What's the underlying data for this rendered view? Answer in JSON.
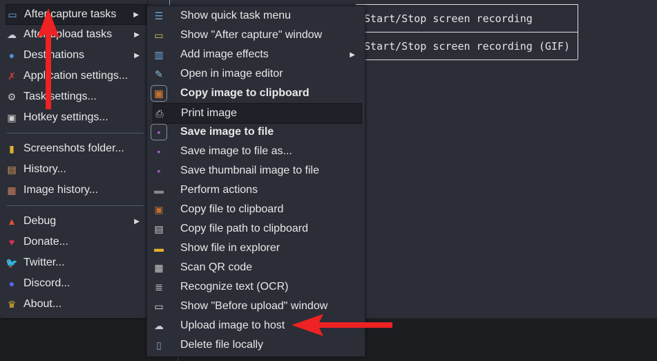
{
  "left_menu": {
    "items": [
      {
        "label": "After capture tasks",
        "icon": "capture-tasks-icon",
        "glyph": "▭",
        "color": "#6fa8dc",
        "submenu": true
      },
      {
        "label": "After upload tasks",
        "icon": "cloud-upload-icon",
        "glyph": "☁",
        "color": "#c8c8d8",
        "submenu": true
      },
      {
        "label": "Destinations",
        "icon": "destinations-icon",
        "glyph": "●",
        "color": "#4a90d9",
        "submenu": true
      },
      {
        "label": "Application settings...",
        "icon": "tools-icon",
        "glyph": "✗",
        "color": "#d04040"
      },
      {
        "label": "Task settings...",
        "icon": "gear-icon",
        "glyph": "⚙",
        "color": "#cccccc"
      },
      {
        "label": "Hotkey settings...",
        "icon": "keyboard-key-icon",
        "glyph": "▣",
        "color": "#cfcfcf"
      },
      {
        "label": "Screenshots folder...",
        "icon": "folder-icon",
        "glyph": "▮",
        "color": "#e0b030"
      },
      {
        "label": "History...",
        "icon": "history-icon",
        "glyph": "▤",
        "color": "#e0a060"
      },
      {
        "label": "Image history...",
        "icon": "image-history-icon",
        "glyph": "▦",
        "color": "#d08060"
      },
      {
        "label": "Debug",
        "icon": "debug-cone-icon",
        "glyph": "▲",
        "color": "#e05030",
        "submenu": true
      },
      {
        "label": "Donate...",
        "icon": "heart-icon",
        "glyph": "♥",
        "color": "#e03050"
      },
      {
        "label": "Twitter...",
        "icon": "twitter-icon",
        "glyph": "🐦",
        "color": "#1da1f2"
      },
      {
        "label": "Discord...",
        "icon": "discord-icon",
        "glyph": "●",
        "color": "#5865f2"
      },
      {
        "label": "About...",
        "icon": "crown-icon",
        "glyph": "♛",
        "color": "#e0b030"
      }
    ]
  },
  "sub_menu": {
    "items": [
      {
        "label": "Show quick task menu",
        "icon": "quick-task-menu-icon",
        "glyph": "☰",
        "color": "#6fa8dc"
      },
      {
        "label": "Show \"After capture\" window",
        "icon": "window-icon",
        "glyph": "▭",
        "color": "#e0c060"
      },
      {
        "label": "Add image effects",
        "icon": "image-effects-icon",
        "glyph": "▥",
        "color": "#6fa8dc",
        "submenu": true
      },
      {
        "label": "Open in image editor",
        "icon": "image-editor-icon",
        "glyph": "✎",
        "color": "#8fc0e0"
      },
      {
        "label": "Copy image to clipboard",
        "icon": "clipboard-icon",
        "glyph": "▣",
        "color": "#c07030",
        "checked": true
      },
      {
        "label": "Print image",
        "icon": "printer-icon",
        "glyph": "⎙",
        "color": "#cccccc",
        "hover": true
      },
      {
        "label": "Save image to file",
        "icon": "floppy-disk-icon",
        "glyph": "▪",
        "color": "#a060c0",
        "checked": true
      },
      {
        "label": "Save image to file as...",
        "icon": "save-as-icon",
        "glyph": "▪",
        "color": "#a060c0"
      },
      {
        "label": "Save thumbnail image to file",
        "icon": "save-thumbnail-icon",
        "glyph": "▪",
        "color": "#a060c0"
      },
      {
        "label": "Perform actions",
        "icon": "terminal-icon",
        "glyph": "▬",
        "color": "#888888"
      },
      {
        "label": "Copy file to clipboard",
        "icon": "copy-file-icon",
        "glyph": "▣",
        "color": "#c07030"
      },
      {
        "label": "Copy file path to clipboard",
        "icon": "copy-path-icon",
        "glyph": "▤",
        "color": "#d0d0d0"
      },
      {
        "label": "Show file in explorer",
        "icon": "folder-icon",
        "glyph": "▬",
        "color": "#e0b030"
      },
      {
        "label": "Scan QR code",
        "icon": "qr-code-icon",
        "glyph": "▦",
        "color": "#cccccc"
      },
      {
        "label": "Recognize text (OCR)",
        "icon": "ocr-icon",
        "glyph": "≣",
        "color": "#cccccc"
      },
      {
        "label": "Show \"Before upload\" window",
        "icon": "before-upload-window-icon",
        "glyph": "▭",
        "color": "#dddddd"
      },
      {
        "label": "Upload image to host",
        "icon": "cloud-upload-icon",
        "glyph": "☁",
        "color": "#c8c8d8"
      },
      {
        "label": "Delete file locally",
        "icon": "delete-file-icon",
        "glyph": "▯",
        "color": "#8fa0c0"
      }
    ]
  },
  "hotkey_table": {
    "rows": [
      "Start/Stop screen recording",
      "Start/Stop screen recording (GIF)"
    ]
  },
  "annotation_color": "#ee2222"
}
